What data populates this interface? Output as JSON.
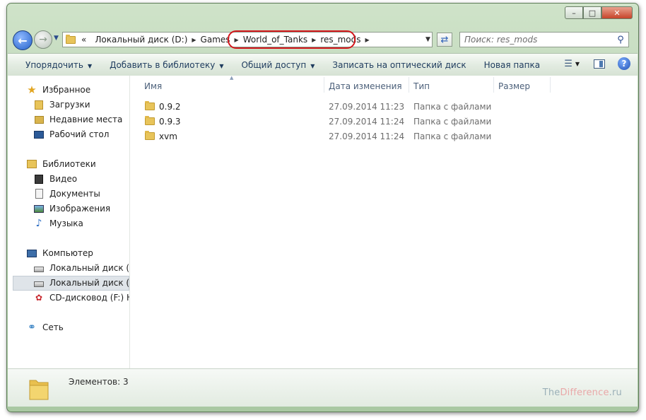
{
  "navigation": {
    "breadcrumbs": [
      "Локальный диск (D:)",
      "Games",
      "World_of_Tanks",
      "res_mods"
    ],
    "overflow_glyph": "«"
  },
  "search": {
    "placeholder": "Поиск: res_mods"
  },
  "toolbar": {
    "organize": "Упорядочить",
    "add_to_library": "Добавить в библиотеку",
    "share": "Общий доступ",
    "burn": "Записать на оптический диск",
    "new_folder": "Новая папка",
    "help_glyph": "?"
  },
  "sidebar": {
    "favorites": {
      "label": "Избранное",
      "items": [
        "Загрузки",
        "Недавние места",
        "Рабочий стол"
      ]
    },
    "libraries": {
      "label": "Библиотеки",
      "items": [
        "Видео",
        "Документы",
        "Изображения",
        "Музыка"
      ]
    },
    "computer": {
      "label": "Компьютер",
      "items": [
        "Локальный диск (C",
        "Локальный диск (D",
        "CD-дисковод (F:) HU"
      ]
    },
    "network": {
      "label": "Сеть"
    }
  },
  "columns": {
    "name": "Имя",
    "date": "Дата изменения",
    "type": "Тип",
    "size": "Размер"
  },
  "files": [
    {
      "name": "0.9.2",
      "date": "27.09.2014 11:23",
      "type": "Папка с файлами"
    },
    {
      "name": "0.9.3",
      "date": "27.09.2014 11:24",
      "type": "Папка с файлами"
    },
    {
      "name": "xvm",
      "date": "27.09.2014 11:24",
      "type": "Папка с файлами"
    }
  ],
  "status": {
    "item_count": "Элементов: 3"
  },
  "watermark": {
    "part1": "The",
    "part2": "Difference",
    "part3": ".ru"
  },
  "colors": {
    "highlight_ring": "#d3161b",
    "frame": "#b9d3b4",
    "accent": "#2461c9"
  }
}
